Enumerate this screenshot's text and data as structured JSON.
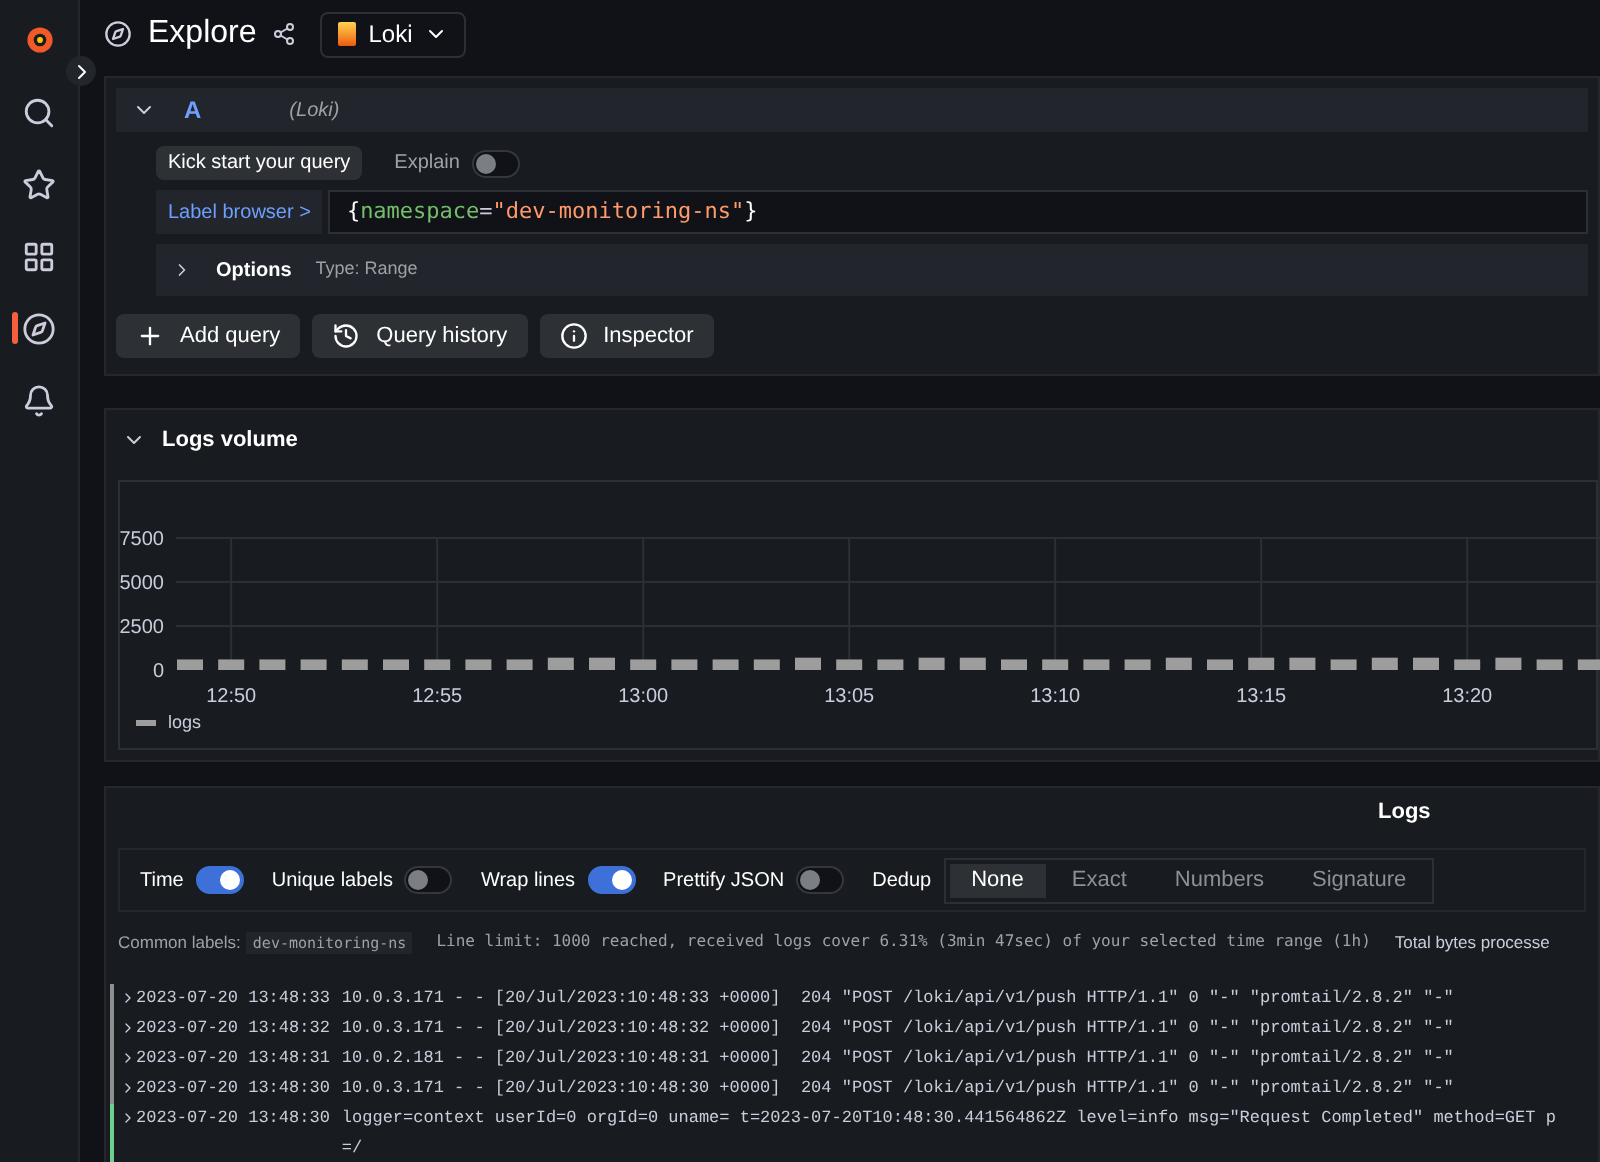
{
  "sidebar": {
    "items": [
      {
        "kind": "logo",
        "selected": false
      },
      {
        "kind": "search",
        "selected": false
      },
      {
        "kind": "star",
        "selected": false
      },
      {
        "kind": "grid",
        "selected": false
      },
      {
        "kind": "compass",
        "selected": true
      },
      {
        "kind": "bell",
        "selected": false
      }
    ]
  },
  "header": {
    "title": "Explore",
    "datasource": "Loki"
  },
  "query": {
    "ref": "A",
    "datasource": "(Loki)",
    "kick_start": "Kick start your query",
    "explain": {
      "label": "Explain",
      "on": false
    },
    "label_browser": "Label browser >",
    "expr_open": "{",
    "expr_key": "namespace",
    "expr_eq": "=",
    "expr_value": "\"dev-monitoring-ns\"",
    "expr_close": "}",
    "options": "Options",
    "options_type": "Type: Range"
  },
  "actions": [
    {
      "kind": "add",
      "label": "Add query"
    },
    {
      "kind": "history",
      "label": "Query history"
    },
    {
      "kind": "info",
      "label": "Inspector"
    }
  ],
  "logs_volume": {
    "title": "Logs volume",
    "chart_data": {
      "type": "bar",
      "grid": true,
      "categories": [
        null,
        "12:50",
        null,
        null,
        null,
        null,
        "12:55",
        null,
        null,
        null,
        null,
        "13:00",
        null,
        null,
        null,
        null,
        "13:05",
        null,
        null,
        null,
        null,
        "13:10",
        null,
        null,
        null,
        null,
        "13:15",
        null,
        null,
        null,
        null,
        "13:20",
        null,
        null,
        null
      ],
      "series": [
        {
          "name": "logs",
          "color": "#9d9d9d",
          "values": [
            600,
            600,
            600,
            600,
            600,
            600,
            600,
            600,
            600,
            700,
            700,
            600,
            600,
            600,
            600,
            700,
            600,
            600,
            700,
            700,
            600,
            600,
            600,
            600,
            700,
            600,
            700,
            700,
            600,
            700,
            700,
            600,
            700,
            600,
            600
          ]
        }
      ],
      "yticks": [
        0,
        2500,
        5000,
        7500
      ],
      "ylim": [
        0,
        7500
      ]
    }
  },
  "logs": {
    "title": "Logs",
    "options": [
      {
        "label": "Time",
        "on": true
      },
      {
        "label": "Unique labels",
        "on": false
      },
      {
        "label": "Wrap lines",
        "on": true
      },
      {
        "label": "Prettify JSON",
        "on": false
      }
    ],
    "dedup_label": "Dedup",
    "dedup": [
      {
        "label": "None",
        "selected": true
      },
      {
        "label": "Exact",
        "selected": false
      },
      {
        "label": "Numbers",
        "selected": false
      },
      {
        "label": "Signature",
        "selected": false
      }
    ],
    "common_labels_label": "Common labels:",
    "common_label": "dev-monitoring-ns",
    "meta": "Line limit: 1000 reached, received logs cover 6.31% (3min 47sec) of your selected time range (1h)",
    "bytes": "Total bytes processe",
    "rows": [
      {
        "color": "#8e8e8e",
        "time": "2023-07-20 13:48:33",
        "lines": [
          "10.0.3.171 - - [20/Jul/2023:10:48:33 +0000]  204 \"POST /loki/api/v1/push HTTP/1.1\" 0 \"-\" \"promtail/2.8.2\" \"-\""
        ]
      },
      {
        "color": "#8e8e8e",
        "time": "2023-07-20 13:48:32",
        "lines": [
          "10.0.3.171 - - [20/Jul/2023:10:48:32 +0000]  204 \"POST /loki/api/v1/push HTTP/1.1\" 0 \"-\" \"promtail/2.8.2\" \"-\""
        ]
      },
      {
        "color": "#8e8e8e",
        "time": "2023-07-20 13:48:31",
        "lines": [
          "10.0.2.181 - - [20/Jul/2023:10:48:31 +0000]  204 \"POST /loki/api/v1/push HTTP/1.1\" 0 \"-\" \"promtail/2.8.2\" \"-\""
        ]
      },
      {
        "color": "#8e8e8e",
        "time": "2023-07-20 13:48:30",
        "lines": [
          "10.0.3.171 - - [20/Jul/2023:10:48:30 +0000]  204 \"POST /loki/api/v1/push HTTP/1.1\" 0 \"-\" \"promtail/2.8.2\" \"-\""
        ]
      },
      {
        "color": "#6ccf8e",
        "time": "2023-07-20 13:48:30",
        "lines": [
          "logger=context userId=0 orgId=0 uname= t=2023-07-20T10:48:30.441564862Z level=info msg=\"Request Completed\" method=GET p",
          "=/"
        ]
      }
    ]
  }
}
